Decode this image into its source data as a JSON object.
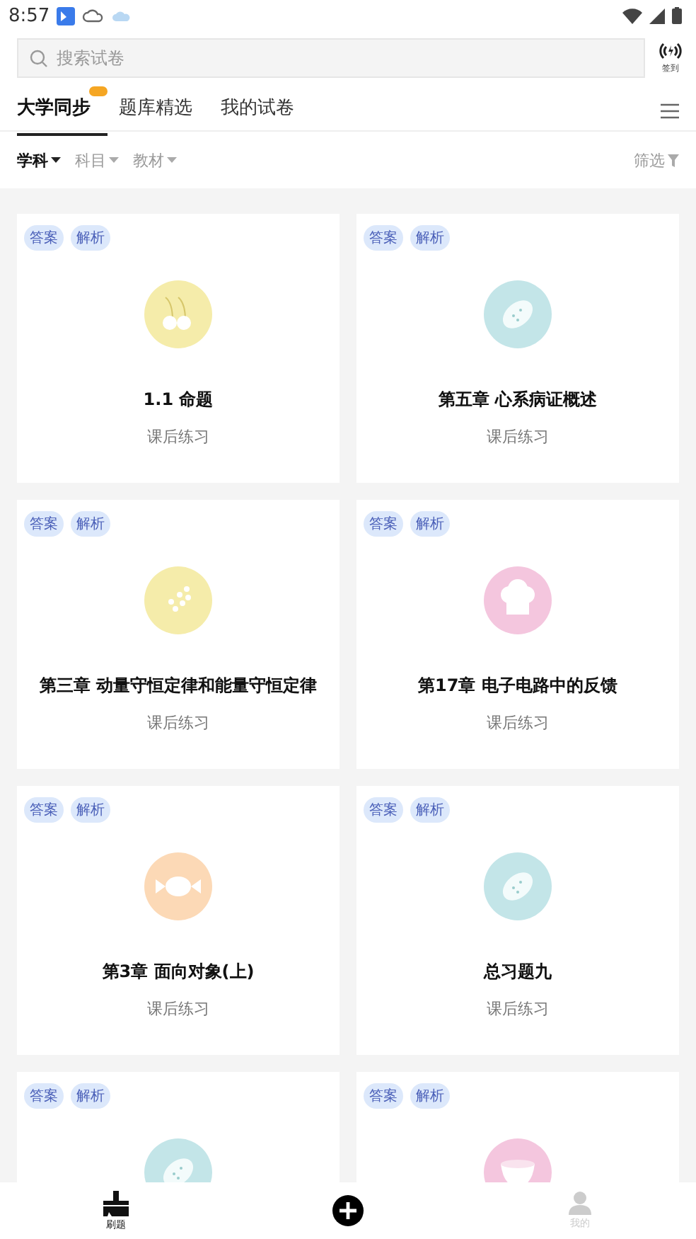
{
  "status_bar": {
    "time": "8:57"
  },
  "search": {
    "placeholder": "搜索试卷"
  },
  "signin": {
    "label": "签到"
  },
  "tabs": [
    {
      "label": "大学同步",
      "selected": true,
      "badge": true
    },
    {
      "label": "题库精选",
      "selected": false,
      "badge": false
    },
    {
      "label": "我的试卷",
      "selected": false,
      "badge": false
    }
  ],
  "filters": [
    {
      "label": "学科",
      "selected": true
    },
    {
      "label": "科目",
      "selected": false
    },
    {
      "label": "教材",
      "selected": false
    }
  ],
  "filter_button": {
    "label": "筛选"
  },
  "cards": [
    {
      "tags": [
        "答案",
        "解析"
      ],
      "title": "1.1 命题",
      "subtitle": "课后练习",
      "color": "#f5ecaa"
    },
    {
      "tags": [
        "答案",
        "解析"
      ],
      "title": "第五章 心系病证概述",
      "subtitle": "课后练习",
      "color": "#c3e5e8"
    },
    {
      "tags": [
        "答案",
        "解析"
      ],
      "title": "第三章 动量守恒定律和能量守恒定律",
      "subtitle": "课后练习",
      "color": "#f5ecaa"
    },
    {
      "tags": [
        "答案",
        "解析"
      ],
      "title": "第17章 电子电路中的反馈",
      "subtitle": "课后练习",
      "color": "#f4c6de"
    },
    {
      "tags": [
        "答案",
        "解析"
      ],
      "title": "第3章 面向对象(上)",
      "subtitle": "课后练习",
      "color": "#fcd9b6"
    },
    {
      "tags": [
        "答案",
        "解析"
      ],
      "title": "总习题九",
      "subtitle": "课后练习",
      "color": "#c3e5e8"
    },
    {
      "tags": [
        "答案",
        "解析"
      ],
      "color": "#c3e5e8"
    },
    {
      "tags": [
        "答案",
        "解析"
      ],
      "color": "#f4c6de"
    }
  ],
  "bottom_nav": [
    {
      "kind": "brush",
      "label": "刷题",
      "selected": true
    },
    {
      "kind": "add",
      "selected": false
    },
    {
      "kind": "user",
      "label": "我的",
      "selected": false
    }
  ]
}
